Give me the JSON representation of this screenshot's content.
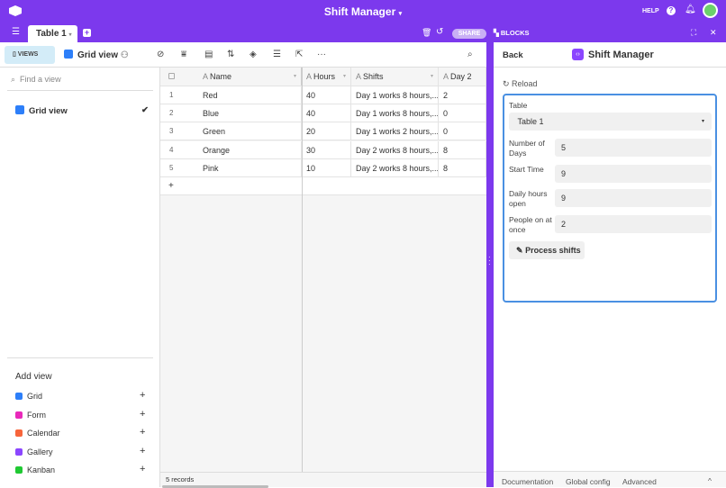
{
  "app": {
    "title": "Shift Manager",
    "help": "HELP",
    "share": "SHARE",
    "blocks": "BLOCKS",
    "tab": "Table 1"
  },
  "toolbar": {
    "views": "VIEWS",
    "view_name": "Grid view",
    "more": "···"
  },
  "sidebar": {
    "search_placeholder": "Find a view",
    "current_view": "Grid view",
    "add_view": "Add view",
    "view_types": [
      {
        "label": "Grid",
        "color": "#2d7ff9"
      },
      {
        "label": "Form",
        "color": "#e929ba"
      },
      {
        "label": "Calendar",
        "color": "#f7653b"
      },
      {
        "label": "Gallery",
        "color": "#8b46ff"
      },
      {
        "label": "Kanban",
        "color": "#20c933"
      }
    ]
  },
  "grid": {
    "columns": [
      "Name",
      "Hours",
      "Shifts",
      "Day 2"
    ],
    "rows": [
      {
        "n": "1",
        "name": "Red",
        "hours": "40",
        "shifts": "Day 1 works 8 hours,...",
        "day2": "2"
      },
      {
        "n": "2",
        "name": "Blue",
        "hours": "40",
        "shifts": "Day 1 works 8 hours,...",
        "day2": "0"
      },
      {
        "n": "3",
        "name": "Green",
        "hours": "20",
        "shifts": "Day 1 works 2 hours,...",
        "day2": "0"
      },
      {
        "n": "4",
        "name": "Orange",
        "hours": "30",
        "shifts": "Day 2 works 8 hours,...",
        "day2": "8"
      },
      {
        "n": "5",
        "name": "Pink",
        "hours": "10",
        "shifts": "Day 2 works 8 hours,...",
        "day2": "8"
      }
    ],
    "add": "+",
    "records": "5 records"
  },
  "panel": {
    "back": "Back",
    "title": "Shift Manager",
    "reload": "Reload",
    "table_label": "Table",
    "table_value": "Table 1",
    "fields": [
      {
        "label": "Number of Days",
        "value": "5"
      },
      {
        "label": "Start Time",
        "value": "9"
      },
      {
        "label": "Daily hours open",
        "value": "9"
      },
      {
        "label": "People on at once",
        "value": "2"
      }
    ],
    "process": "Process shifts",
    "footer": [
      "Documentation",
      "Global config",
      "Advanced"
    ]
  }
}
